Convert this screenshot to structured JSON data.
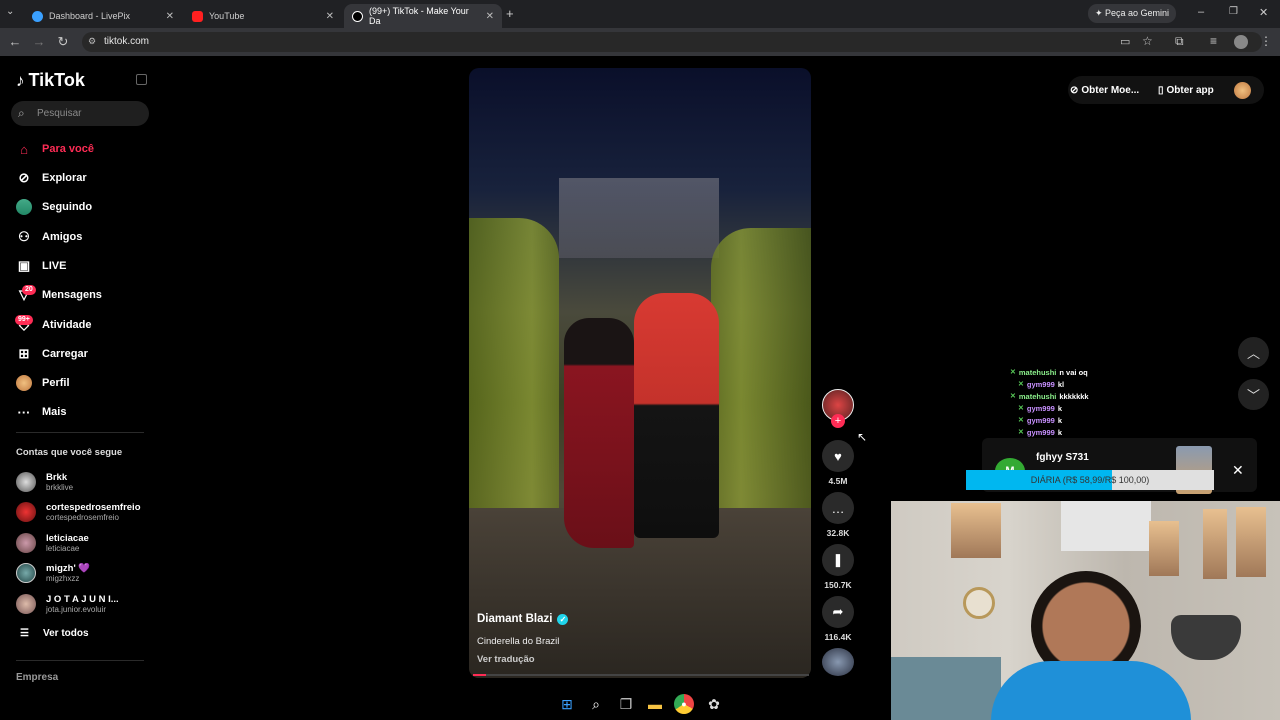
{
  "browser": {
    "tabs": [
      {
        "title": "Dashboard - LivePix",
        "icon": "livepix-icon"
      },
      {
        "title": "YouTube",
        "icon": "youtube-icon"
      },
      {
        "title": "(99+) TikTok - Make Your Da",
        "icon": "tiktok-icon"
      }
    ],
    "gemini_button": "Peça ao Gemini",
    "url": "tiktok.com"
  },
  "sidebar": {
    "logo": "TikTok",
    "search_placeholder": "Pesquisar",
    "nav": [
      {
        "label": "Para você",
        "icon": "home-icon",
        "active": true
      },
      {
        "label": "Explorar",
        "icon": "compass-icon"
      },
      {
        "label": "Seguindo",
        "icon": "following-avatar-icon"
      },
      {
        "label": "Amigos",
        "icon": "friends-icon"
      },
      {
        "label": "LIVE",
        "icon": "live-tv-icon"
      },
      {
        "label": "Mensagens",
        "icon": "messages-icon",
        "badge": "20"
      },
      {
        "label": "Atividade",
        "icon": "activity-icon",
        "badge": "99+"
      },
      {
        "label": "Carregar",
        "icon": "upload-icon"
      },
      {
        "label": "Perfil",
        "icon": "profile-avatar-icon"
      },
      {
        "label": "Mais",
        "icon": "more-icon"
      }
    ],
    "following_title": "Contas que você segue",
    "accounts": [
      {
        "name": "Brkk",
        "handle": "brkklive"
      },
      {
        "name": "cortespedrosemfreio",
        "handle": "cortespedrosemfreio"
      },
      {
        "name": "leticiacae",
        "handle": "leticiacae"
      },
      {
        "name": "migzh' 💜",
        "handle": "migzhxzz"
      },
      {
        "name": "J O T A J U N I...",
        "handle": "jota.junior.evoluir"
      }
    ],
    "see_all": "Ver todos",
    "footer": "Empresa"
  },
  "video": {
    "author": "Diamant Blazi",
    "description": "Cinderella do Brazil",
    "translate": "Ver tradução",
    "progress": 0.04
  },
  "actions": {
    "likes": "4.5M",
    "comments": "32.8K",
    "saves": "150.7K",
    "shares": "116.4K"
  },
  "topright": {
    "coins": "Obter Moe...",
    "app": "Obter app"
  },
  "chat": [
    {
      "user": "matehushi",
      "msg": "n vai oq",
      "color": "green"
    },
    {
      "user": "gym999",
      "msg": "kl",
      "color": "purple"
    },
    {
      "user": "matehushi",
      "msg": "kkkkkkk",
      "color": "green"
    },
    {
      "user": "gym999",
      "msg": "k",
      "color": "purple"
    },
    {
      "user": "gym999",
      "msg": "k",
      "color": "purple"
    },
    {
      "user": "gym999",
      "msg": "k",
      "color": "purple"
    },
    {
      "user": "gym999",
      "msg": "k",
      "color": "purple"
    }
  ],
  "donation": {
    "donor": "fghyy S731",
    "goal_text": "DIÁRIA (R$ 58,99/R$ 100,00)",
    "progress": 0.59
  },
  "colors": {
    "accent": "#fe2c55",
    "goal_bar": "#00b7f0"
  }
}
